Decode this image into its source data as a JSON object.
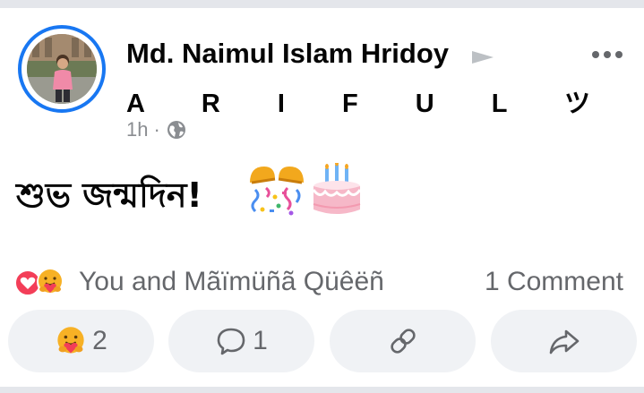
{
  "post": {
    "author": "Md. Naimul Islam Hridoy",
    "recipient": "A R I F U L ツ",
    "time": "1h",
    "separator": "·",
    "privacy_icon": "globe-icon",
    "text": "শুভ জন্মদিন!",
    "emojis": [
      "party-popper",
      "birthday-cake"
    ]
  },
  "reactions": {
    "icons": [
      "love-heart-icon",
      "care-hug-icon"
    ],
    "summary": "You and Mãïmüñã Qüêëñ",
    "comments": "1 Comment"
  },
  "actions": [
    {
      "name": "react",
      "icon": "care-hug-icon",
      "count": "2"
    },
    {
      "name": "comment",
      "icon": "comment-bubble-icon",
      "count": "1"
    },
    {
      "name": "copy-link",
      "icon": "link-icon",
      "count": ""
    },
    {
      "name": "share",
      "icon": "share-arrow-icon",
      "count": ""
    }
  ],
  "colors": {
    "accent": "#1877f2",
    "secondary_text": "#65676b",
    "button_bg": "#f0f2f5",
    "divider": "#e4e6eb"
  }
}
